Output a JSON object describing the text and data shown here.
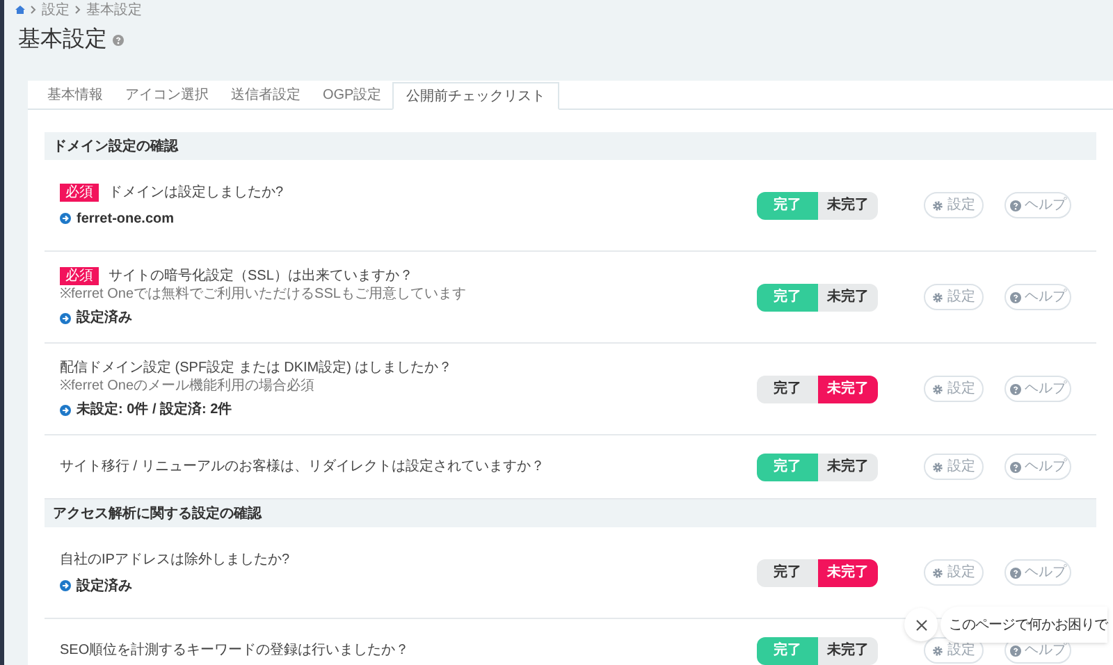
{
  "breadcrumb": [
    "設定",
    "基本設定"
  ],
  "title": "基本設定",
  "tabs": [
    {
      "label": "基本情報",
      "selected": false
    },
    {
      "label": "アイコン選択",
      "selected": false
    },
    {
      "label": "送信者設定",
      "selected": false
    },
    {
      "label": "OGP設定",
      "selected": false
    },
    {
      "label": "公開前チェックリスト",
      "selected": true
    }
  ],
  "sections": [
    {
      "heading": "ドメイン設定の確認",
      "items": [
        {
          "badge": "必須",
          "question": "ドメインは設定しましたか?",
          "link": "ferret-one.com",
          "toggle": [
            {
              "label": "完了",
              "selected": true
            },
            {
              "label": "未完了",
              "selected": false
            }
          ],
          "settings": "設定",
          "help": "ヘルプ"
        },
        {
          "badge": "必須",
          "question": "サイトの暗号化設定（SSL）は出来ていますか？",
          "note": "※ferret Oneでは無料でご利用いただけるSSLもご用意しています",
          "link": "設定済み",
          "toggle": [
            {
              "label": "完了",
              "selected": true
            },
            {
              "label": "未完了",
              "selected": false
            }
          ],
          "settings": "設定",
          "help": "ヘルプ"
        },
        {
          "question": "配信ドメイン設定 (SPF設定 または DKIM設定) はしましたか？",
          "note": "※ferret Oneのメール機能利用の場合必須",
          "link": "未設定: 0件 / 設定済: 2件",
          "toggle": [
            {
              "label": "完了",
              "selected": false
            },
            {
              "label": "未完了",
              "selected": true
            }
          ],
          "settings": "設定",
          "help": "ヘルプ"
        },
        {
          "question": "サイト移行 / リニューアルのお客様は、リダイレクトは設定されていますか？",
          "toggle": [
            {
              "label": "完了",
              "selected": true
            },
            {
              "label": "未完了",
              "selected": false
            }
          ],
          "settings": "設定",
          "help": "ヘルプ"
        }
      ]
    },
    {
      "heading": "アクセス解析に関する設定の確認",
      "items": [
        {
          "question": "自社のIPアドレスは除外しましたか?",
          "link": "設定済み",
          "toggle": [
            {
              "label": "完了",
              "selected": false
            },
            {
              "label": "未完了",
              "selected": true
            }
          ],
          "settings": "設定",
          "help": "ヘルプ"
        },
        {
          "question": "SEO順位を計測するキーワードの登録は行いましたか？",
          "toggle": [
            {
              "label": "完了",
              "selected": true
            },
            {
              "label": "未完了",
              "selected": false
            }
          ],
          "settings": "設定",
          "help": "ヘルプ"
        }
      ]
    }
  ],
  "chat": {
    "message": "このページで何かお困りで"
  }
}
